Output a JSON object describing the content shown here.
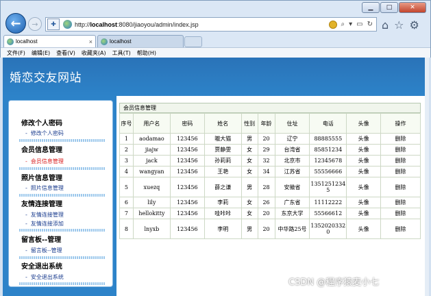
{
  "browser": {
    "url_prefix": "http://",
    "url_host": "localhost",
    "url_rest": ":8080/jiaoyou/admin/index.jsp",
    "tabs": [
      {
        "label": "localhost",
        "active": true
      },
      {
        "label": "localhost",
        "active": false
      }
    ],
    "menu": [
      "文件(F)",
      "编辑(E)",
      "查看(V)",
      "收藏夹(A)",
      "工具(T)",
      "帮助(H)"
    ],
    "close_tab_glyph": "×",
    "window_buttons": [
      "▁",
      "□",
      "✕"
    ]
  },
  "site": {
    "title": "婚恋交友网站"
  },
  "sidebar": {
    "groups": [
      {
        "title": "修改个人密码",
        "items": [
          {
            "label": "修改个人密码",
            "active": false
          }
        ]
      },
      {
        "title": "会员信息管理",
        "items": [
          {
            "label": "会员信息管理",
            "active": true
          }
        ]
      },
      {
        "title": "照片信息管理",
        "items": [
          {
            "label": "照片信息管理",
            "active": false
          }
        ]
      },
      {
        "title": "友情连接管理",
        "items": [
          {
            "label": "友情连接管理",
            "active": false
          },
          {
            "label": "友情连接添加",
            "active": false
          }
        ]
      },
      {
        "title": "留言板--管理",
        "items": [
          {
            "label": "留言板--管理",
            "active": false
          }
        ]
      },
      {
        "title": "安全退出系统",
        "items": [
          {
            "label": "安全退出系统",
            "active": false
          }
        ]
      }
    ],
    "dash": "-"
  },
  "main": {
    "panel_title": "会员信息管理",
    "columns": [
      "序号",
      "用户名",
      "密码",
      "姓名",
      "性别",
      "年龄",
      "住址",
      "电话",
      "头像",
      "操作"
    ],
    "rows": [
      [
        "1",
        "aodamao",
        "123456",
        "嗷大猫",
        "男",
        "20",
        "辽宁",
        "88885555",
        "头像",
        "删除"
      ],
      [
        "2",
        "jiajw",
        "123456",
        "贾静雯",
        "女",
        "29",
        "台湾省",
        "85851234",
        "头像",
        "删除"
      ],
      [
        "3",
        "jack",
        "123456",
        "孙莉莉",
        "女",
        "32",
        "北京市",
        "12345678",
        "头像",
        "删除"
      ],
      [
        "4",
        "wangyan",
        "123456",
        "王艳",
        "女",
        "34",
        "江苏省",
        "55556666",
        "头像",
        "删除"
      ],
      [
        "5",
        "xuezq",
        "123456",
        "薛之谦",
        "男",
        "28",
        "安徽省",
        "13512512345",
        "头像",
        "删除"
      ],
      [
        "6",
        "lily",
        "123456",
        "李莉",
        "女",
        "26",
        "广东省",
        "11112222",
        "头像",
        "删除"
      ],
      [
        "7",
        "hellokitty",
        "123456",
        "哇咔咔",
        "女",
        "20",
        "东京大学",
        "55566612",
        "头像",
        "删除"
      ],
      [
        "8",
        "lnyxb",
        "123456",
        "李明",
        "男",
        "20",
        "中华路25号",
        "13520203320",
        "头像",
        "删除"
      ]
    ]
  },
  "watermark": "CSDN @程序猿麦小七",
  "colors": {
    "header": "#2d83c9",
    "accent_red": "#d81e1e",
    "link": "#1a3c8e"
  }
}
